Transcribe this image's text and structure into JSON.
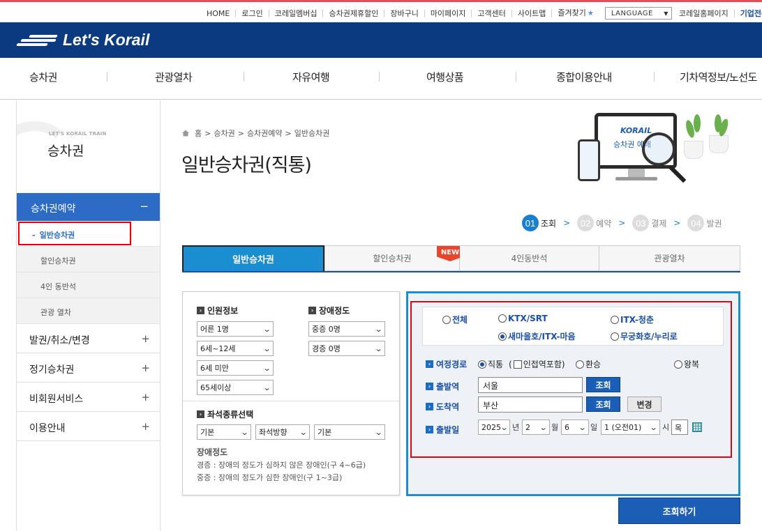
{
  "util": {
    "links": [
      "HOME",
      "로그인",
      "코레일멤버십",
      "승차권제휴할인",
      "장바구니",
      "마이페이지",
      "고객센터",
      "사이트맵",
      "즐겨찾기"
    ],
    "language": "LANGUAGE",
    "homepage": "코레일홈페이지",
    "corporate": "기업전용"
  },
  "header": {
    "logo": "Let's Korail"
  },
  "gnb": [
    "승차권",
    "관광열차",
    "자유여행",
    "여행상품",
    "종합이용안내",
    "기차역정보/노선도"
  ],
  "lnb": {
    "brand_small": "LET'S KORAIL TRAIN",
    "brand_title": "승차권",
    "active_menu": "승차권예약",
    "active_sign": "−",
    "subs": [
      "일반승차권",
      "할인승차권",
      "4인 동반석",
      "관광 열차"
    ],
    "sub_dash": "-",
    "menus": [
      "발권/취소/변경",
      "정기승차권",
      "비회원서비스",
      "이용안내"
    ],
    "plus": "+"
  },
  "breadcrumb": {
    "items": [
      "홈",
      "승차권",
      "승차권예약",
      "일반승차권"
    ],
    "sep": ">"
  },
  "page_title": "일반승차권(직통)",
  "illus": {
    "logo": "KORAIL",
    "text": "승차권 예매"
  },
  "steps": [
    {
      "num": "01",
      "label": "조회"
    },
    {
      "num": "02",
      "label": "예약"
    },
    {
      "num": "03",
      "label": "결제"
    },
    {
      "num": "04",
      "label": "발권"
    }
  ],
  "step_chev": ">",
  "tabs": [
    "일반승차권",
    "할인승차권",
    "4인동반석",
    "관광열차"
  ],
  "new_badge": "NEW",
  "passenger": {
    "title": "인원정보",
    "adult": "어른 1명",
    "child": "6세~12세",
    "infant": "6세 미만",
    "senior": "65세이상"
  },
  "disability": {
    "title": "장애정도",
    "severe": "중증 0명",
    "mild": "경증 0명"
  },
  "seat": {
    "title": "좌석종류선택",
    "type": "기본",
    "direction": "좌석방향",
    "extra": "기본"
  },
  "notes": {
    "title": "장애정도",
    "mild": "경증 : 장애의 정도가 심하지 않은 장애인(구 4~6급)",
    "severe": "중증 : 장애의 정도가 심한 장애인(구 1~3급)"
  },
  "train_types": [
    "전체",
    "KTX/SRT",
    "ITX-청춘",
    "새마을호/ITX-마음",
    "무궁화호/누리로"
  ],
  "route": {
    "label": "여정경로",
    "direct": "직통",
    "nearby": "인접역포함",
    "transfer": "환승",
    "roundtrip": "왕복"
  },
  "departure": {
    "label": "출발역",
    "value": "서울",
    "search": "조회"
  },
  "arrival": {
    "label": "도착역",
    "value": "부산",
    "search": "조회",
    "swap": "변경"
  },
  "date": {
    "label": "출발일",
    "year": "2025",
    "year_unit": "년",
    "month": "2",
    "month_unit": "월",
    "day": "6",
    "day_unit": "일",
    "hour": "1 (오전01)",
    "hour_unit": "시",
    "weekday": "목"
  },
  "submit": "조회하기",
  "dropdown_glyph": "⌄",
  "bullet": "›"
}
